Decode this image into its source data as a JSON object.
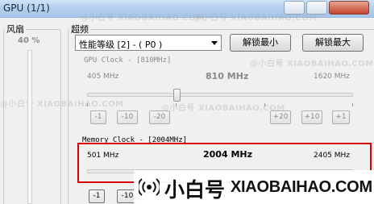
{
  "window": {
    "title": "GPU (1/1)"
  },
  "fan": {
    "label": "风扇",
    "percent": "40 %"
  },
  "overclock": {
    "label": "超频",
    "performance_level": "性能等级 [2] - ( P0 )",
    "unlock_min": "解锁最小",
    "unlock_max": "解锁最大"
  },
  "gpu_clock": {
    "label": "GPU Clock - [810MHz]",
    "min": "405 MHz",
    "current": "810 MHz",
    "max": "1620 MHz",
    "step_buttons": [
      "-1",
      "-10",
      "-20",
      "+20",
      "+10",
      "+1"
    ]
  },
  "memory_clock": {
    "label": "Memory Clock - [2004MHz]",
    "min": "501 MHz",
    "current": "2004 MHz",
    "max": "2405 MHz",
    "step_buttons": [
      "-1",
      "-10"
    ]
  },
  "watermark": "@小白号  XIAOBAIHAO.COM",
  "brand": {
    "cn": "小白号",
    "en": "XIAOBAIHAO.COM"
  },
  "colors": {
    "highlight_border": "#d90000",
    "titlebar": "#b4d0ee"
  }
}
